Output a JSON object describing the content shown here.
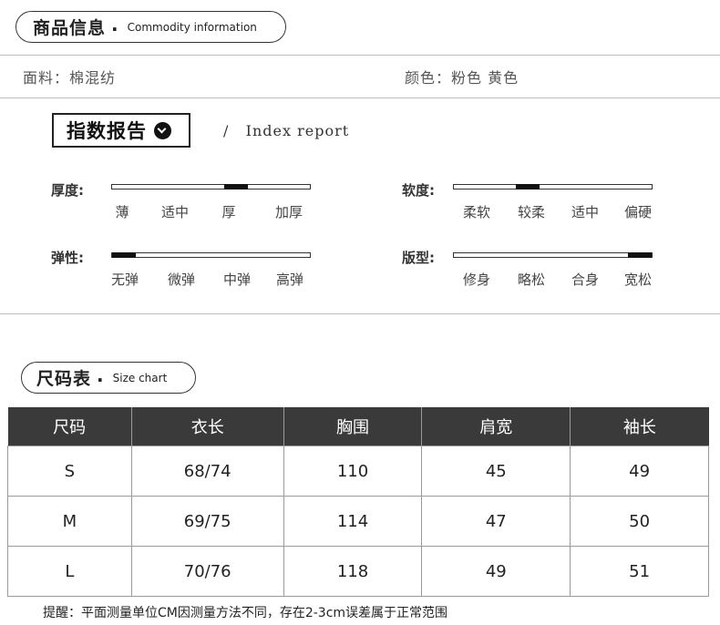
{
  "commodity": {
    "title": "商品信息",
    "dot": ".",
    "subtitle": "Commodity information"
  },
  "fabric": {
    "material": "面料：棉混纺",
    "colors": "颜色：粉色 黄色"
  },
  "index": {
    "title": "指数报告",
    "slash": "/",
    "subtitle": "Index report"
  },
  "scales": [
    {
      "label": "厚度:",
      "options": [
        "薄",
        "适中",
        "厚",
        "加厚"
      ],
      "selected_index": 2
    },
    {
      "label": "软度:",
      "options": [
        "柔软",
        "较柔",
        "适中",
        "偏硬"
      ],
      "selected_index": 1
    },
    {
      "label": "弹性:",
      "options": [
        "无弹",
        "微弹",
        "中弹",
        "高弹"
      ],
      "selected_index": 0
    },
    {
      "label": "版型:",
      "options": [
        "修身",
        "略松",
        "合身",
        "宽松"
      ],
      "selected_index": 3
    }
  ],
  "sizechart": {
    "title": "尺码表",
    "dot": ".",
    "subtitle": "Size chart"
  },
  "table": {
    "headers": [
      "尺码",
      "衣长",
      "胸围",
      "肩宽",
      "袖长"
    ],
    "rows": [
      [
        "S",
        "68/74",
        "110",
        "45",
        "49"
      ],
      [
        "M",
        "69/75",
        "114",
        "47",
        "50"
      ],
      [
        "L",
        "70/76",
        "118",
        "49",
        "51"
      ]
    ]
  },
  "note": "提醒：平面测量单位CM因测量方法不同，存在2-3cm误差属于正常范围"
}
